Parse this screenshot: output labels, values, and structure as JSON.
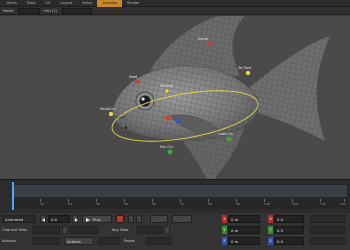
{
  "menu": {
    "tabs": [
      "Items",
      "Tools",
      "UV",
      "Layout",
      "Setup",
      "Animate",
      "Render"
    ],
    "active": "Animate"
  },
  "toolbar": {
    "model_label": "Model",
    "layer_label": "Fish (1)"
  },
  "handles": {
    "head": "Head",
    "mouth": "MouthCtrl",
    "dorsal": "Dorsal",
    "tail": "Tail Root",
    "pectoral": "Pectoral",
    "lower": "Lower Fin",
    "left_fin": "FinL Ctrl"
  },
  "timeline": {
    "ticks": [
      "0",
      "12",
      "24",
      "36",
      "48",
      "60",
      "72",
      "84",
      "96",
      "108",
      "120",
      "132",
      "144"
    ]
  },
  "controls": {
    "mode_select": "Animated",
    "frame_value": "0.0",
    "play_label": "Play",
    "channel_sets_label": "Channel Sets",
    "key_sets_label": "Key Sets",
    "actions_label": "Actions",
    "actions_button": "Actions",
    "poses_label": "Poses",
    "position_x": "0 m",
    "position_y": "0 m",
    "position_z": "0 m",
    "rot_x": "0.0",
    "rot_y": "0.0",
    "rot_z": "0.0",
    "axis_x": "X",
    "axis_y": "Y",
    "axis_z": "Z"
  },
  "colors": {
    "accent": "#c9882a",
    "handle_green": "#3fa83f",
    "handle_red": "#d0402d",
    "handle_blue": "#3a55c8",
    "ring_yellow": "#e3d64a"
  }
}
